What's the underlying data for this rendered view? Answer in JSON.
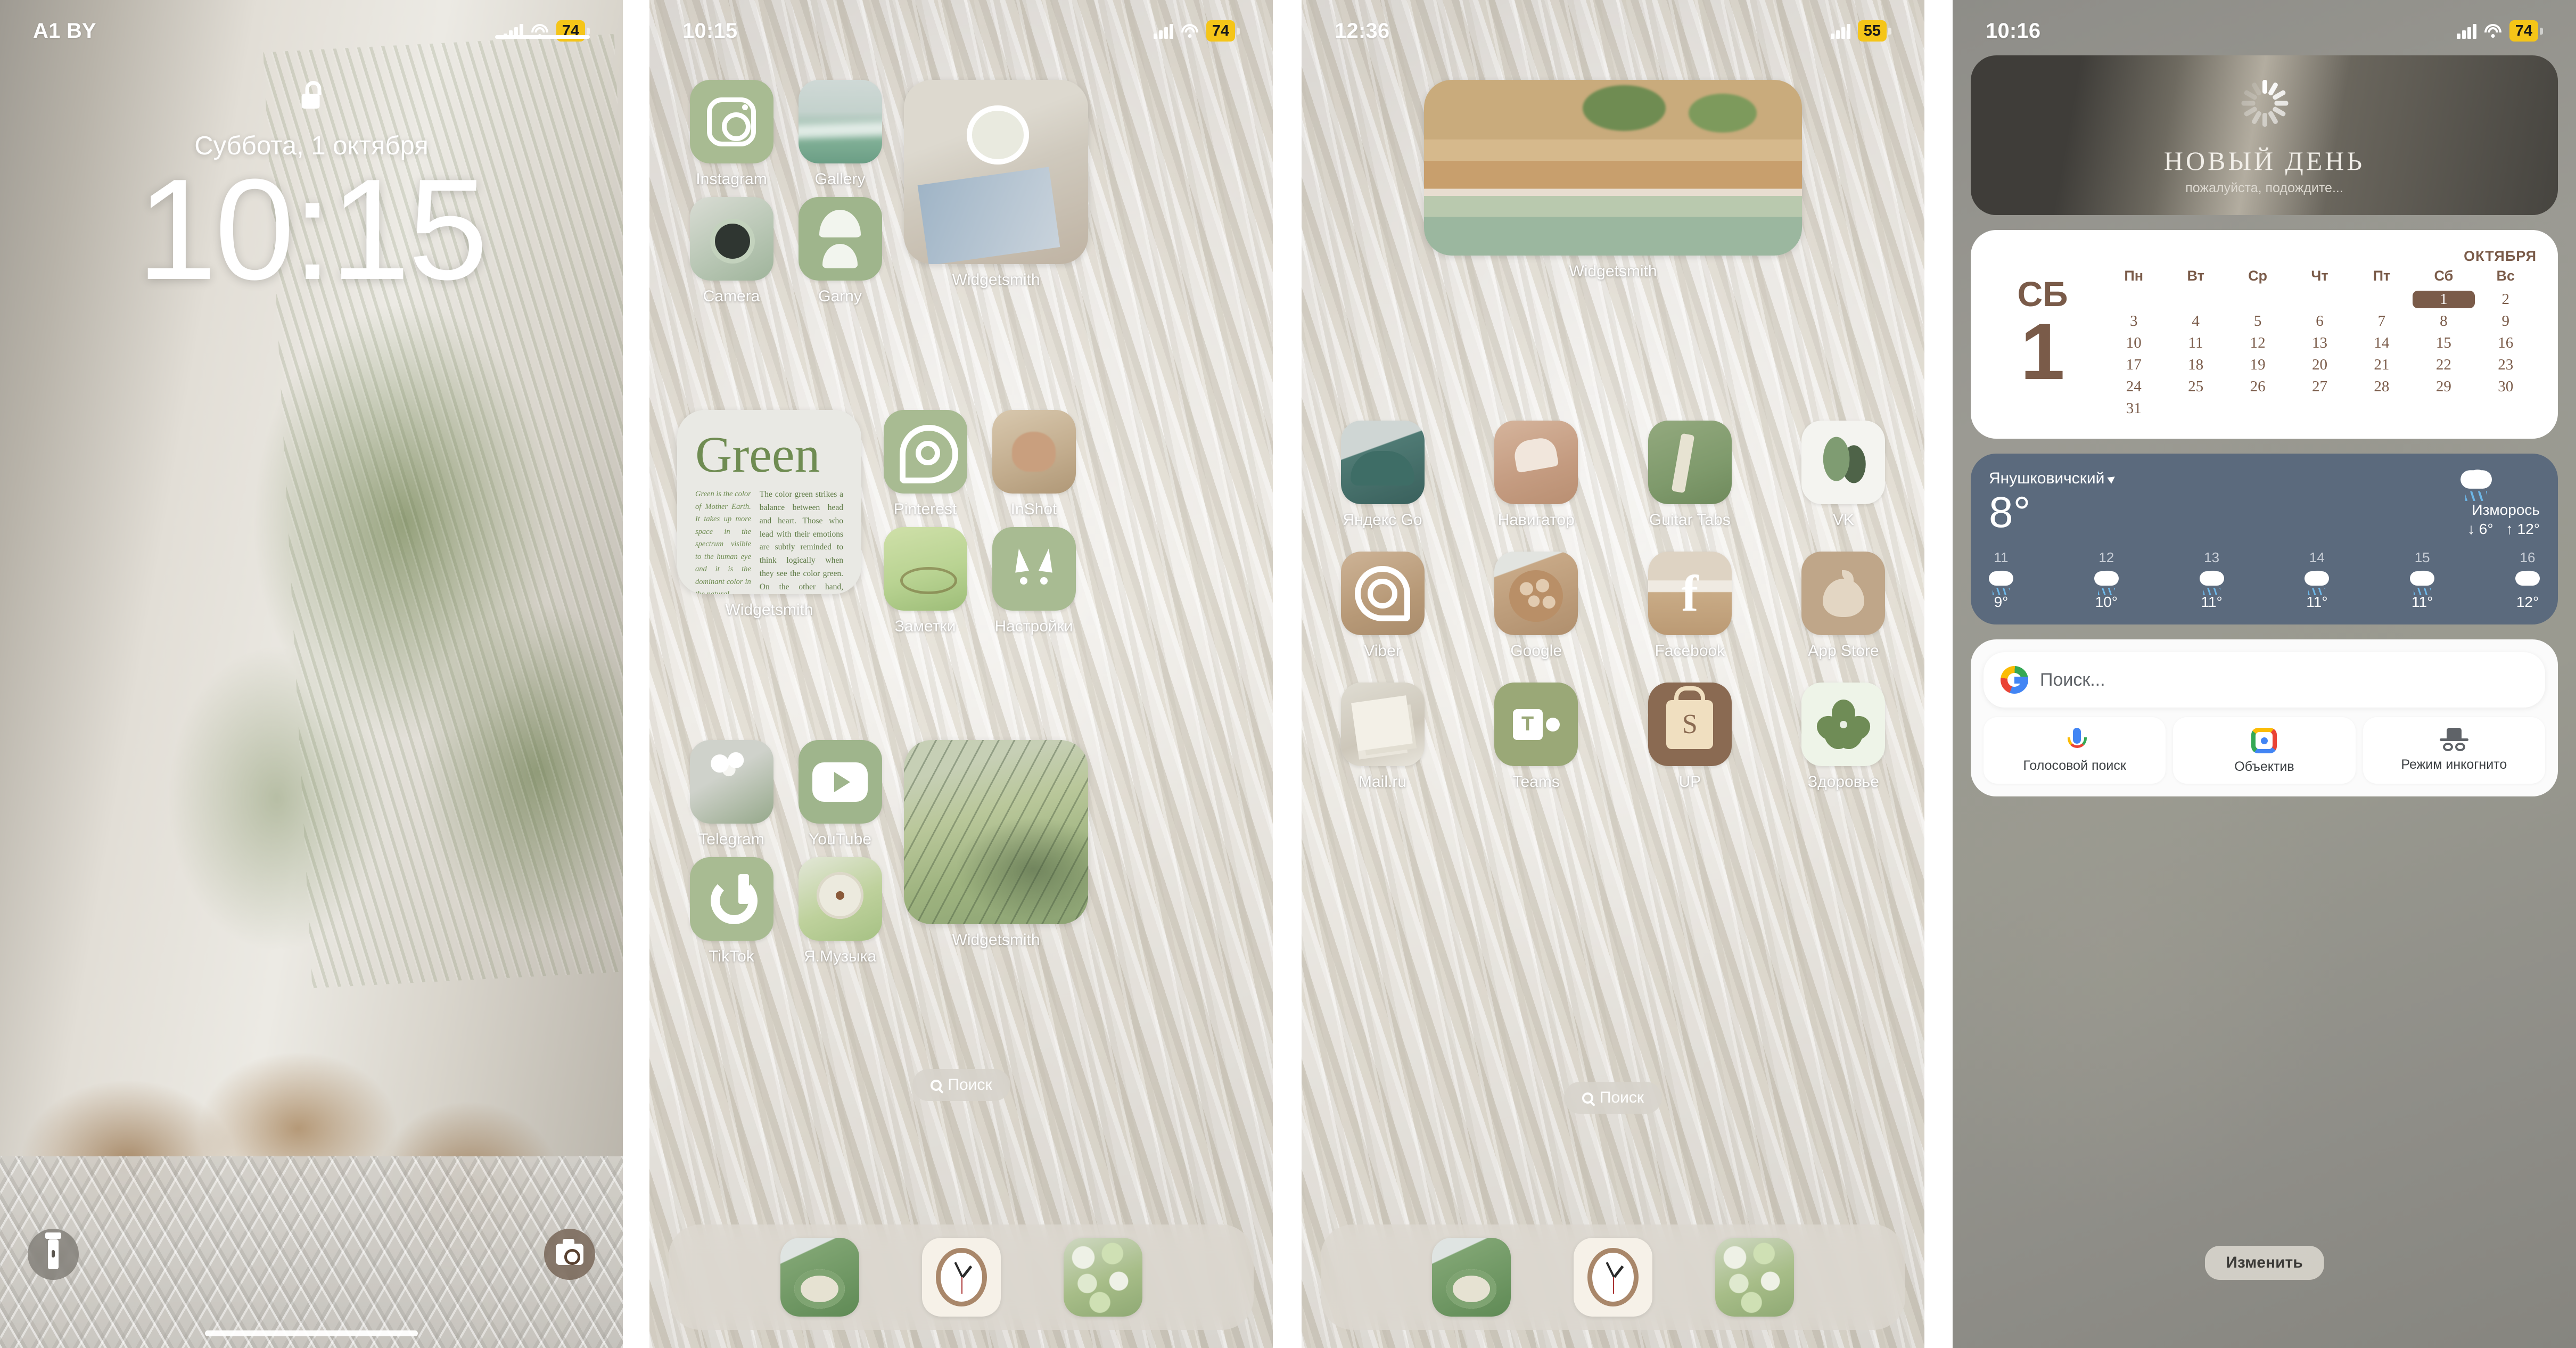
{
  "panels": {
    "lock": {
      "status": {
        "carrier": "A1 BY",
        "battery": "74"
      },
      "date": "Суббота, 1 октября",
      "time": "10:15",
      "flashlight_icon": "torch-icon",
      "camera_icon": "camera-icon"
    },
    "home1": {
      "status": {
        "time": "10:15",
        "battery": "74"
      },
      "apps_row1": [
        {
          "label": "Instagram",
          "art": "sage",
          "glyph": "instagram"
        },
        {
          "label": "Gallery",
          "art": "art-ocean",
          "glyph": ""
        }
      ],
      "apps_row2": [
        {
          "label": "Camera",
          "art": "art-camera",
          "glyph": ""
        },
        {
          "label": "Garny",
          "art": "sage2",
          "glyph": "ginkgo"
        }
      ],
      "widget_top": {
        "label": "Widgetsmith"
      },
      "widget_green": {
        "label": "Widgetsmith",
        "title": "Green",
        "col_a": "Green is the color of Mother Earth. It takes up more space in the spectrum visible to the human eye and it is the dominant color in the natural.",
        "col_b": "The color green strikes a balance between head and heart. Those who lead with their emotions are subtly reminded to think logically when they see the color green. On the other hand, unfeeling individuals may become more sentimental when they cross paths with this viridescent shade. The color green encourages us to have a healthy relationship with our feelings."
      },
      "apps_mid": [
        {
          "label": "Pinterest",
          "art": "sage",
          "glyph": "pinterest"
        },
        {
          "label": "InShot",
          "art": "art-nails",
          "glyph": ""
        },
        {
          "label": "Заметки",
          "art": "art-vangogh",
          "glyph": ""
        },
        {
          "label": "Настройки",
          "art": "sage",
          "glyph": "cat"
        }
      ],
      "apps_row4": [
        {
          "label": "Telegram",
          "art": "art-tulip",
          "glyph": ""
        },
        {
          "label": "YouTube",
          "art": "sage2",
          "glyph": "youtube"
        }
      ],
      "apps_row5": [
        {
          "label": "TikTok",
          "art": "sage",
          "glyph": "tiktok"
        },
        {
          "label": "Я.Музыка",
          "art": "art-vinyl",
          "glyph": ""
        }
      ],
      "widget_fern": {
        "label": "Widgetsmith"
      },
      "search_label": "Поиск",
      "dock": [
        {
          "name": "Телефон",
          "art": "art-phone"
        },
        {
          "name": "Часы",
          "art": "art-clock"
        },
        {
          "name": "Клавиатура",
          "art": "art-keys"
        }
      ]
    },
    "home2": {
      "status": {
        "time": "12:36",
        "battery": "55"
      },
      "widget_beach": {
        "label": "Widgetsmith"
      },
      "apps": [
        {
          "label": "Яндекс Go",
          "art": "art-car",
          "glyph": ""
        },
        {
          "label": "Навигатор",
          "art": "art-shoes",
          "glyph": ""
        },
        {
          "label": "Guitar Tabs",
          "art": "art-guitar",
          "glyph": ""
        },
        {
          "label": "VK",
          "art": "art-plant",
          "glyph": ""
        },
        {
          "label": "Viber",
          "art": "art-viber",
          "glyph": "whatsapp"
        },
        {
          "label": "Google",
          "art": "art-coffee",
          "glyph": ""
        },
        {
          "label": "Facebook",
          "art": "art-fbsand",
          "glyph": "facebook"
        },
        {
          "label": "App Store",
          "art": "art-appstore",
          "glyph": "apple"
        },
        {
          "label": "Mail.ru",
          "art": "art-mail",
          "glyph": ""
        },
        {
          "label": "Teams",
          "art": "art-teams",
          "glyph": "teams"
        },
        {
          "label": "UP",
          "art": "art-up",
          "glyph": "bag"
        },
        {
          "label": "Здоровье",
          "art": "art-health",
          "glyph": "flower"
        }
      ],
      "search_label": "Поиск",
      "dock": [
        {
          "name": "Телефон",
          "art": "art-phone"
        },
        {
          "name": "Часы",
          "art": "art-clock"
        },
        {
          "name": "Клавиатура",
          "art": "art-keys"
        }
      ]
    },
    "today": {
      "status": {
        "time": "10:16",
        "battery": "74"
      },
      "newday": {
        "title": "НОВЫЙ ДЕНЬ",
        "subtitle": "пожалуйста, подождите..."
      },
      "calendar": {
        "dow": "СБ",
        "day": "1",
        "month": "ОКТЯБРЯ",
        "weekday_headers": [
          "Пн",
          "Вт",
          "Ср",
          "Чт",
          "Пт",
          "Сб",
          "Вс"
        ],
        "leading_blanks": 5,
        "days": [
          1,
          2,
          3,
          4,
          5,
          6,
          7,
          8,
          9,
          10,
          11,
          12,
          13,
          14,
          15,
          16,
          17,
          18,
          19,
          20,
          21,
          22,
          23,
          24,
          25,
          26,
          27,
          28,
          29,
          30,
          31
        ],
        "today": 1
      },
      "weather": {
        "city": "Янушковичский",
        "temp": "8°",
        "condition": "Изморось",
        "low": "↓ 6°",
        "high": "↑ 12°",
        "hours": [
          {
            "hour": "11",
            "temp": "9°",
            "icon": "rain-cloud-icon"
          },
          {
            "hour": "12",
            "temp": "10°",
            "icon": "rain-cloud-icon"
          },
          {
            "hour": "13",
            "temp": "11°",
            "icon": "rain-cloud-icon"
          },
          {
            "hour": "14",
            "temp": "11°",
            "icon": "rain-cloud-icon"
          },
          {
            "hour": "15",
            "temp": "11°",
            "icon": "rain-cloud-icon"
          },
          {
            "hour": "16",
            "temp": "12°",
            "icon": "cloud-icon"
          }
        ]
      },
      "google": {
        "placeholder": "Поиск...",
        "tiles": [
          {
            "label": "Голосовой поиск",
            "icon": "microphone-icon"
          },
          {
            "label": "Объектив",
            "icon": "lens-icon"
          },
          {
            "label": "Режим инкогнито",
            "icon": "incognito-icon"
          }
        ]
      },
      "edit_label": "Изменить"
    }
  },
  "colors": {
    "sage": "#a8bb92",
    "battery_badge": "#f5c518",
    "calendar_brown": "#7a5b49",
    "weather_bg": "#5b6a7d"
  }
}
